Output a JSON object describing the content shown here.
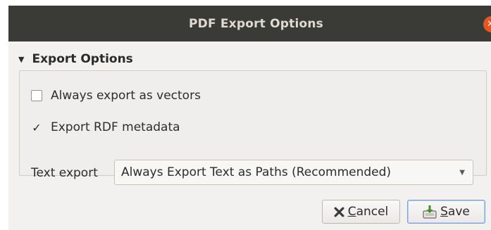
{
  "dialog": {
    "title": "PDF Export Options",
    "close_icon": "close-icon",
    "accent_color": "#e95420"
  },
  "export_options": {
    "group_title": "Export Options",
    "collapse_icon": "triangle-down-icon",
    "always_vectors": {
      "label": "Always export as vectors",
      "checked": false
    },
    "rdf_metadata": {
      "label": "Export RDF metadata",
      "checked": true
    },
    "text_export": {
      "label": "Text export",
      "selected": "Always Export Text as Paths (Recommended)"
    }
  },
  "buttons": {
    "cancel": {
      "mnemonic": "C",
      "rest": "ancel",
      "icon": "cancel-x-icon"
    },
    "save": {
      "mnemonic": "S",
      "rest": "ave",
      "icon": "save-icon"
    }
  }
}
